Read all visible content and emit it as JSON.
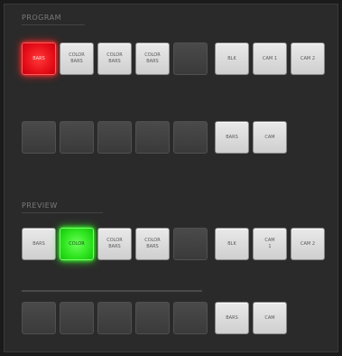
{
  "program": {
    "title": "PROGRAM",
    "row1": [
      {
        "label": "BARS",
        "state": "red"
      },
      {
        "label": "COLOR\nBARS",
        "state": "light"
      },
      {
        "label": "COLOR\nBARS",
        "state": "light"
      },
      {
        "label": "COLOR\nBARS",
        "state": "light"
      },
      {
        "label": "",
        "state": "dark"
      },
      {
        "label": "BLK",
        "state": "light"
      },
      {
        "label": "CAM 1",
        "state": "light"
      },
      {
        "label": "CAM 2",
        "state": "light"
      }
    ],
    "row2": [
      {
        "label": "",
        "state": "dark"
      },
      {
        "label": "",
        "state": "dark"
      },
      {
        "label": "",
        "state": "dark"
      },
      {
        "label": "",
        "state": "dark"
      },
      {
        "label": "",
        "state": "dark"
      },
      {
        "label": "BARS",
        "state": "light"
      },
      {
        "label": "CAM",
        "state": "light"
      }
    ]
  },
  "preview": {
    "title": "PREVIEW",
    "row1": [
      {
        "label": "BARS",
        "state": "light"
      },
      {
        "label": "COLOR",
        "state": "green"
      },
      {
        "label": "COLOR\nBARS",
        "state": "light"
      },
      {
        "label": "COLOR\nBARS",
        "state": "light"
      },
      {
        "label": "",
        "state": "dark"
      },
      {
        "label": "BLK",
        "state": "light"
      },
      {
        "label": "CAM\n1",
        "state": "light"
      },
      {
        "label": "CAM 2",
        "state": "light"
      }
    ],
    "row2": [
      {
        "label": "",
        "state": "dark"
      },
      {
        "label": "",
        "state": "dark"
      },
      {
        "label": "",
        "state": "dark"
      },
      {
        "label": "",
        "state": "dark"
      },
      {
        "label": "",
        "state": "dark"
      },
      {
        "label": "BARS",
        "state": "light"
      },
      {
        "label": "CAM",
        "state": "light"
      }
    ]
  }
}
